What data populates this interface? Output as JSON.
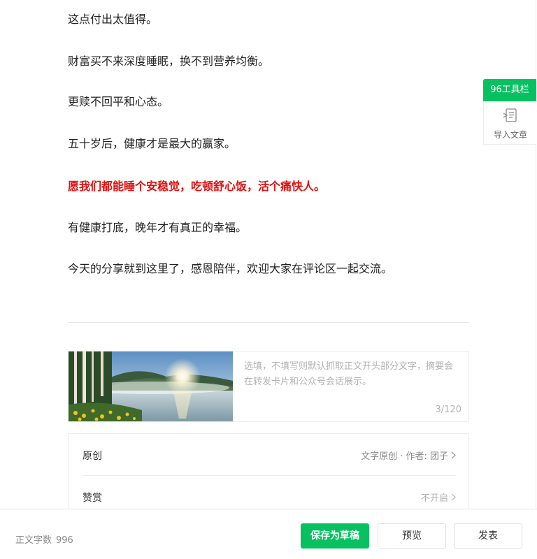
{
  "article": {
    "paragraphs": [
      {
        "text": "这点付出太值得。",
        "emphasis": false
      },
      {
        "text": "财富买不来深度睡眠，换不到营养均衡。",
        "emphasis": false
      },
      {
        "text": "更赎不回平和心态。",
        "emphasis": false
      },
      {
        "text": "五十岁后，健康才是最大的赢家。",
        "emphasis": false
      },
      {
        "text": "愿我们都能睡个安稳觉，吃顿舒心饭，活个痛快人。",
        "emphasis": true
      },
      {
        "text": "有健康打底，晚年才有真正的幸福。",
        "emphasis": false
      },
      {
        "text": "今天的分享就到这里了，感恩陪伴，欢迎大家在评论区一起交流。",
        "emphasis": false
      }
    ],
    "emphasis_color": "#e20f0f"
  },
  "cover": {
    "image": "lake-sunrise-forest-flowers",
    "summary_placeholder": "选填，不填写则默认抓取正文开头部分文字，摘要会在转发卡片和公众号会话展示。",
    "counter": "3/120"
  },
  "settings": {
    "original": {
      "label": "原创",
      "value": "文字原创 · 作者: 团子"
    },
    "reward": {
      "label": "赞赏",
      "value": "不开启"
    }
  },
  "side_panel": {
    "toolbar_tag": "96工具栏",
    "import_icon": "import-article-icon",
    "import_label": "导入文章"
  },
  "footer": {
    "wordcount_label": "正文字数",
    "wordcount_value": "996",
    "save_draft": "保存为草稿",
    "preview": "预览",
    "publish": "发表"
  },
  "colors": {
    "brand_green": "#07c160",
    "muted_text": "#b2b2b2"
  }
}
